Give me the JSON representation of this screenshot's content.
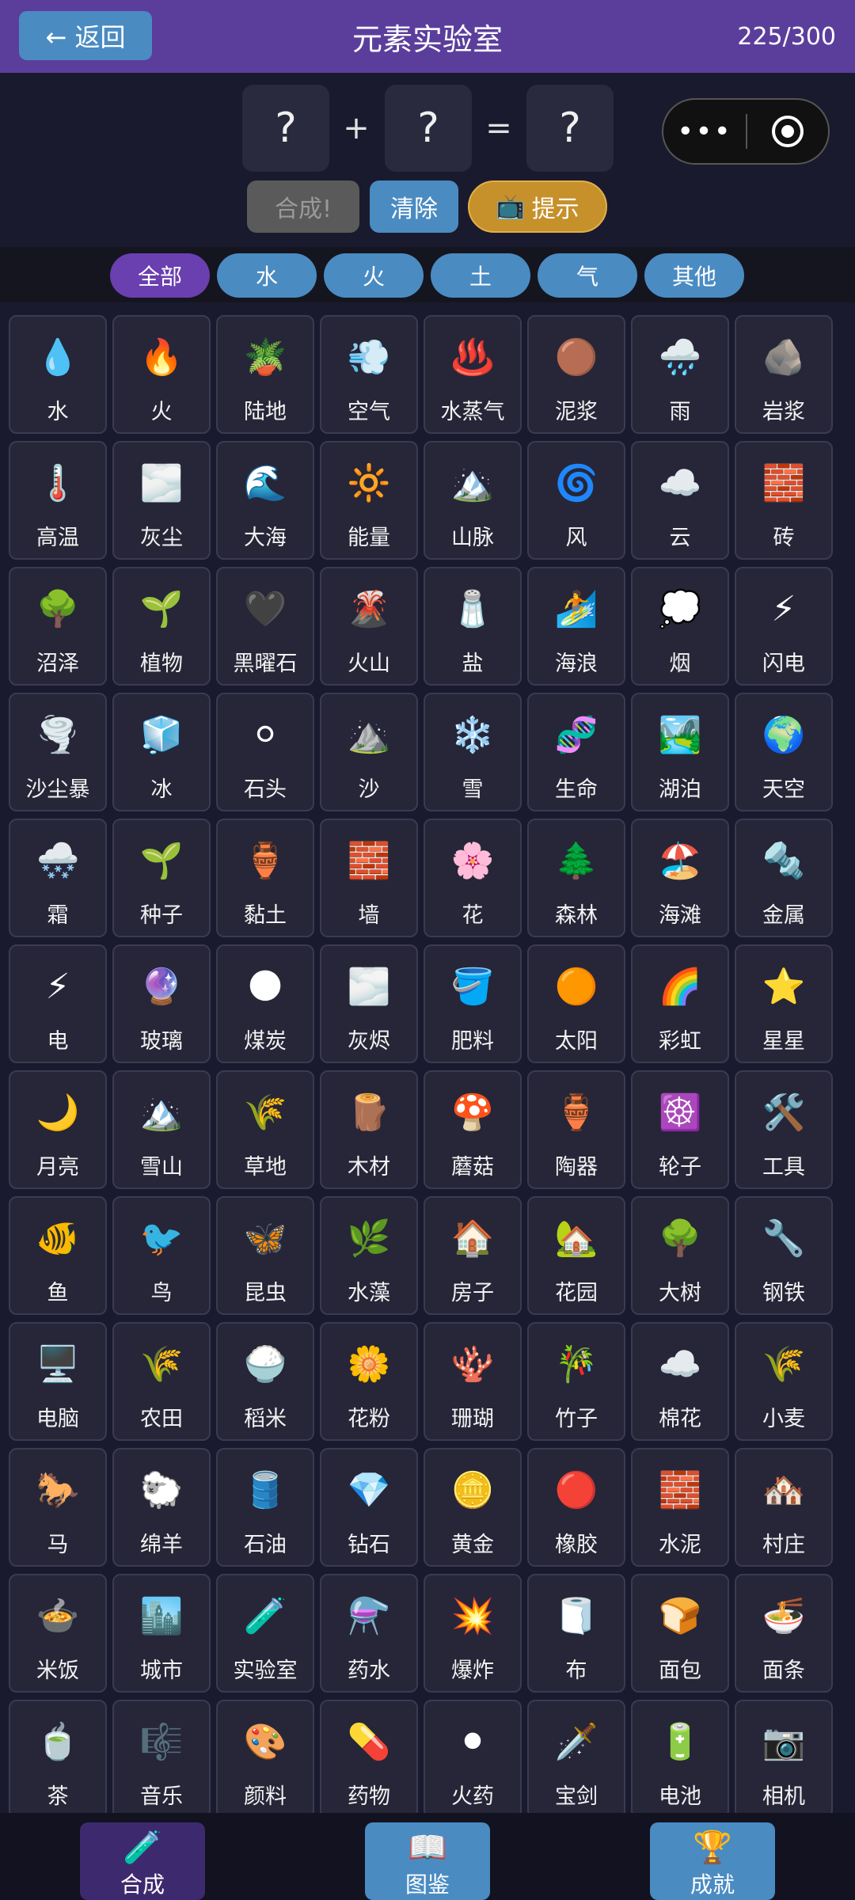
{
  "header": {
    "back_label": "← 返回",
    "title": "元素实验室",
    "progress": "225/300"
  },
  "formula": {
    "slot1": "?",
    "plus": "+",
    "slot2": "?",
    "equals": "=",
    "result": "?"
  },
  "capsule": {
    "more": "•••"
  },
  "actions": {
    "combine": "合成!",
    "clear": "清除",
    "hint_icon": "📺",
    "hint": "提示"
  },
  "filters": {
    "active_color": "#6a3fb0",
    "inactive_color": "#4a8bc2",
    "tabs": [
      "全部",
      "水",
      "火",
      "土",
      "气",
      "其他"
    ]
  },
  "elements": [
    {
      "icon": "💧",
      "label": "水"
    },
    {
      "icon": "🔥",
      "label": "火"
    },
    {
      "icon": "🪴",
      "label": "陆地"
    },
    {
      "icon": "💨",
      "label": "空气"
    },
    {
      "icon": "♨️",
      "label": "水蒸气"
    },
    {
      "icon": "🟤",
      "label": "泥浆"
    },
    {
      "icon": "🌧️",
      "label": "雨"
    },
    {
      "icon": "🪨",
      "label": "岩浆"
    },
    {
      "icon": "🌡️",
      "label": "高温"
    },
    {
      "icon": "🌫️",
      "label": "灰尘"
    },
    {
      "icon": "🌊",
      "label": "大海"
    },
    {
      "icon": "🔆",
      "label": "能量"
    },
    {
      "icon": "🏔️",
      "label": "山脉"
    },
    {
      "icon": "🌀",
      "label": "风"
    },
    {
      "icon": "☁️",
      "label": "云"
    },
    {
      "icon": "🧱",
      "label": "砖"
    },
    {
      "icon": "🌳",
      "label": "沼泽"
    },
    {
      "icon": "🌱",
      "label": "植物"
    },
    {
      "icon": "🖤",
      "label": "黑曜石"
    },
    {
      "icon": "🌋",
      "label": "火山"
    },
    {
      "icon": "🧂",
      "label": "盐"
    },
    {
      "icon": "🏄",
      "label": "海浪"
    },
    {
      "icon": "💭",
      "label": "烟"
    },
    {
      "icon": "⚡",
      "label": "闪电"
    },
    {
      "icon": "🌪️",
      "label": "沙尘暴"
    },
    {
      "icon": "🧊",
      "label": "冰"
    },
    {
      "icon": "⚪",
      "label": "石头"
    },
    {
      "icon": "⛰️",
      "label": "沙"
    },
    {
      "icon": "❄️",
      "label": "雪"
    },
    {
      "icon": "🧬",
      "label": "生命"
    },
    {
      "icon": "🏞️",
      "label": "湖泊"
    },
    {
      "icon": "🌍",
      "label": "天空"
    },
    {
      "icon": "🌨️",
      "label": "霜"
    },
    {
      "icon": "🌱",
      "label": "种子"
    },
    {
      "icon": "🏺",
      "label": "黏土"
    },
    {
      "icon": "🧱",
      "label": "墙"
    },
    {
      "icon": "🌸",
      "label": "花"
    },
    {
      "icon": "🌲",
      "label": "森林"
    },
    {
      "icon": "🏖️",
      "label": "海滩"
    },
    {
      "icon": "🔩",
      "label": "金属"
    },
    {
      "icon": "⚡",
      "label": "电"
    },
    {
      "icon": "🔮",
      "label": "玻璃"
    },
    {
      "icon": "🌑",
      "label": "煤炭"
    },
    {
      "icon": "🌫️",
      "label": "灰烬"
    },
    {
      "icon": "🪣",
      "label": "肥料"
    },
    {
      "icon": "🟠",
      "label": "太阳"
    },
    {
      "icon": "🌈",
      "label": "彩虹"
    },
    {
      "icon": "⭐",
      "label": "星星"
    },
    {
      "icon": "🌙",
      "label": "月亮"
    },
    {
      "icon": "🏔️",
      "label": "雪山"
    },
    {
      "icon": "🌾",
      "label": "草地"
    },
    {
      "icon": "🪵",
      "label": "木材"
    },
    {
      "icon": "🍄",
      "label": "蘑菇"
    },
    {
      "icon": "🏺",
      "label": "陶器"
    },
    {
      "icon": "☸️",
      "label": "轮子"
    },
    {
      "icon": "🛠️",
      "label": "工具"
    },
    {
      "icon": "🐠",
      "label": "鱼"
    },
    {
      "icon": "🐦",
      "label": "鸟"
    },
    {
      "icon": "🦋",
      "label": "昆虫"
    },
    {
      "icon": "🌿",
      "label": "水藻"
    },
    {
      "icon": "🏠",
      "label": "房子"
    },
    {
      "icon": "🏡",
      "label": "花园"
    },
    {
      "icon": "🌳",
      "label": "大树"
    },
    {
      "icon": "🔧",
      "label": "钢铁"
    },
    {
      "icon": "🖥️",
      "label": "电脑"
    },
    {
      "icon": "🌾",
      "label": "农田"
    },
    {
      "icon": "🍚",
      "label": "稻米"
    },
    {
      "icon": "🌼",
      "label": "花粉"
    },
    {
      "icon": "🪸",
      "label": "珊瑚"
    },
    {
      "icon": "🎋",
      "label": "竹子"
    },
    {
      "icon": "☁️",
      "label": "棉花"
    },
    {
      "icon": "🌾",
      "label": "小麦"
    },
    {
      "icon": "🐎",
      "label": "马"
    },
    {
      "icon": "🐑",
      "label": "绵羊"
    },
    {
      "icon": "🛢️",
      "label": "石油"
    },
    {
      "icon": "💎",
      "label": "钻石"
    },
    {
      "icon": "🪙",
      "label": "黄金"
    },
    {
      "icon": "🔴",
      "label": "橡胶"
    },
    {
      "icon": "🧱",
      "label": "水泥"
    },
    {
      "icon": "🏘️",
      "label": "村庄"
    },
    {
      "icon": "🍲",
      "label": "米饭"
    },
    {
      "icon": "🏙️",
      "label": "城市"
    },
    {
      "icon": "🧪",
      "label": "实验室"
    },
    {
      "icon": "⚗️",
      "label": "药水"
    },
    {
      "icon": "💥",
      "label": "爆炸"
    },
    {
      "icon": "🧻",
      "label": "布"
    },
    {
      "icon": "🍞",
      "label": "面包"
    },
    {
      "icon": "🍜",
      "label": "面条"
    },
    {
      "icon": "🍵",
      "label": "茶"
    },
    {
      "icon": "🎼",
      "label": "音乐"
    },
    {
      "icon": "🎨",
      "label": "颜料"
    },
    {
      "icon": "💊",
      "label": "药物"
    },
    {
      "icon": "⚫",
      "label": "火药"
    },
    {
      "icon": "🗡️",
      "label": "宝剑"
    },
    {
      "icon": "🔋",
      "label": "电池"
    },
    {
      "icon": "📷",
      "label": "相机"
    }
  ],
  "nav": {
    "items": [
      {
        "icon": "🧪",
        "label": "合成"
      },
      {
        "icon": "📖",
        "label": "图鉴"
      },
      {
        "icon": "🏆",
        "label": "成就"
      }
    ]
  }
}
